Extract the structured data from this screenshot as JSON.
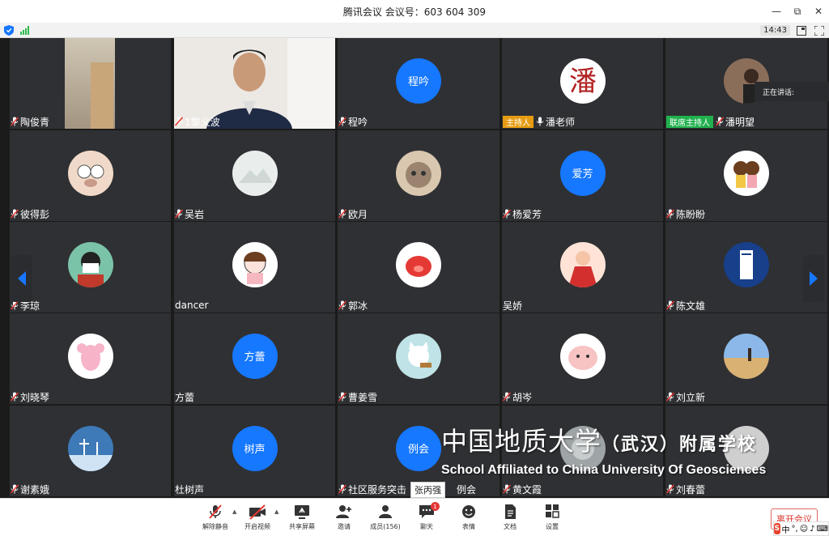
{
  "window": {
    "title": "腾讯会议 会议号：603 604 309",
    "controls": [
      "minimize",
      "restore",
      "close"
    ]
  },
  "status": {
    "time": "14:43"
  },
  "colors": {
    "accent": "#1677ff",
    "host": "#e69c12",
    "cohost": "#21b14e",
    "tile_bg": "#2f3033",
    "leave": "#d93025"
  },
  "speaking_label": "正在讲话:",
  "participants": [
    {
      "name": "陶俊青",
      "avatar": "video-room",
      "mic": true
    },
    {
      "name": "1黎义波",
      "avatar": "video-man",
      "mic": true
    },
    {
      "name": "程吟",
      "avatar": "text",
      "avatar_text": "程吟",
      "mic": true
    },
    {
      "name": "潘老师",
      "avatar": "calligraphy",
      "role": "主持人",
      "role_type": "host",
      "mic": "on"
    },
    {
      "name": "潘明望",
      "avatar": "photo-person",
      "role": "联席主持人",
      "role_type": "cohost",
      "mic": true
    },
    {
      "name": "彼得彭",
      "avatar": "pig-glasses",
      "mic": true
    },
    {
      "name": "吴岩",
      "avatar": "mountain",
      "mic": true
    },
    {
      "name": "欧月",
      "avatar": "cat",
      "mic": true
    },
    {
      "name": "杨爱芳",
      "avatar": "text",
      "avatar_text": "爱芳",
      "mic": true
    },
    {
      "name": "陈盼盼",
      "avatar": "dolls",
      "mic": true
    },
    {
      "name": "李琼",
      "avatar": "boy-mask",
      "mic": true
    },
    {
      "name": "dancer",
      "avatar": "girl-cartoon",
      "mic": false
    },
    {
      "name": "郭冰",
      "avatar": "red-pig",
      "mic": true
    },
    {
      "name": "吴娇",
      "avatar": "red-costume",
      "mic": false
    },
    {
      "name": "陈文雄",
      "avatar": "blue-book",
      "mic": true
    },
    {
      "name": "刘晓琴",
      "avatar": "pink-pig",
      "mic": true
    },
    {
      "name": "方蕾",
      "avatar": "text",
      "avatar_text": "方蕾",
      "mic": false
    },
    {
      "name": "曹姜雪",
      "avatar": "white-cat",
      "mic": true
    },
    {
      "name": "胡岑",
      "avatar": "pink-blob",
      "mic": true
    },
    {
      "name": "刘立新",
      "avatar": "desert",
      "mic": true
    },
    {
      "name": "谢素娥",
      "avatar": "winter-tree",
      "mic": true
    },
    {
      "name": "杜树声",
      "avatar": "text",
      "avatar_text": "树声",
      "mic": false
    },
    {
      "name": "社区服务突击",
      "name_tail": "例会",
      "avatar": "text",
      "avatar_text": "例会",
      "mic": true
    },
    {
      "name": "黄文霞",
      "avatar": "blur",
      "mic": true
    },
    {
      "name": "刘春蕾",
      "avatar": "grey",
      "mic": true
    }
  ],
  "tooltip": "张丙强",
  "watermark": {
    "cn_main": "中国地质大学",
    "cn_paren": "（武汉）附属学校",
    "en": "School Affiliated to China University Of Geosciences"
  },
  "toolbar": {
    "unmute": "解除静音",
    "video": "开启视频",
    "share": "共享屏幕",
    "invite": "邀请",
    "members": "成员(156)",
    "chat": "聊天",
    "chat_badge": "1",
    "emoji": "表情",
    "docs": "文档",
    "settings": "设置",
    "leave": "离开会议"
  },
  "ime": {
    "logo": "S",
    "mode": "中"
  }
}
